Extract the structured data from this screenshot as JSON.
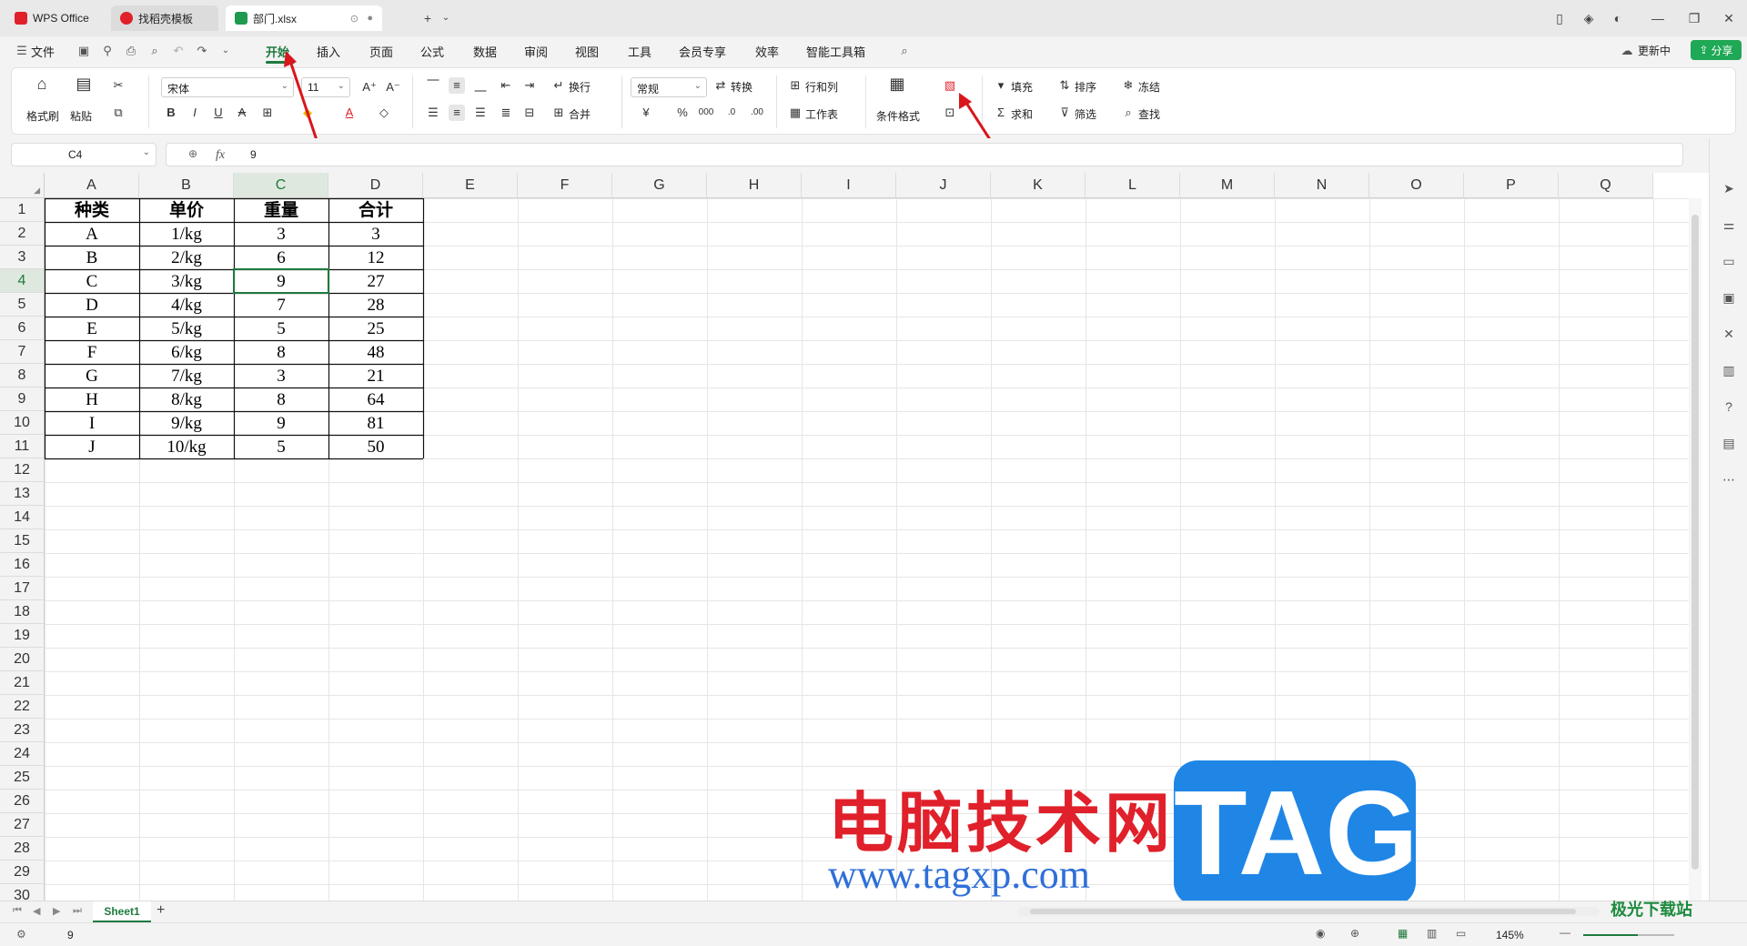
{
  "tabs": [
    {
      "label": "WPS Office",
      "color": "#e0202a"
    },
    {
      "label": "找稻壳模板",
      "color": "#e0202a"
    },
    {
      "label": "部门.xlsx",
      "color": "#1e9a4e"
    }
  ],
  "menu": {
    "file": "文件",
    "items": [
      "开始",
      "插入",
      "页面",
      "公式",
      "数据",
      "审阅",
      "视图",
      "工具",
      "会员专享",
      "效率",
      "智能工具箱"
    ],
    "active": "开始",
    "update": "更新中",
    "share": "分享"
  },
  "ribbon": {
    "format_painter": "格式刷",
    "paste": "粘贴",
    "font_name": "宋体",
    "font_size": "11",
    "wrap": "换行",
    "merge": "合并",
    "number_format": "常规",
    "convert": "转换",
    "rowcol": "行和列",
    "worksheet": "工作表",
    "cond_format": "条件格式",
    "fill": "填充",
    "sort": "排序",
    "freeze": "冻结",
    "sum": "求和",
    "filter": "筛选",
    "find": "查找"
  },
  "formula_bar": {
    "name_box": "C4",
    "fx": "fx",
    "value": "9"
  },
  "columns": [
    "A",
    "B",
    "C",
    "D",
    "E",
    "F",
    "G",
    "H",
    "I",
    "J",
    "K",
    "L",
    "M",
    "N",
    "O",
    "P",
    "Q"
  ],
  "rows": [
    "1",
    "2",
    "3",
    "4",
    "5",
    "6",
    "7",
    "8",
    "9",
    "10",
    "11",
    "12",
    "13",
    "14",
    "15",
    "16",
    "17",
    "18",
    "19",
    "20",
    "21",
    "22",
    "23",
    "24",
    "25",
    "26",
    "27",
    "28",
    "29",
    "30"
  ],
  "table": {
    "headers": [
      "种类",
      "单价",
      "重量",
      "合计"
    ],
    "data": [
      [
        "A",
        "1/kg",
        "3",
        "3"
      ],
      [
        "B",
        "2/kg",
        "6",
        "12"
      ],
      [
        "C",
        "3/kg",
        "9",
        "27"
      ],
      [
        "D",
        "4/kg",
        "7",
        "28"
      ],
      [
        "E",
        "5/kg",
        "5",
        "25"
      ],
      [
        "F",
        "6/kg",
        "8",
        "48"
      ],
      [
        "G",
        "7/kg",
        "3",
        "21"
      ],
      [
        "H",
        "8/kg",
        "8",
        "64"
      ],
      [
        "I",
        "9/kg",
        "9",
        "81"
      ],
      [
        "J",
        "10/kg",
        "5",
        "50"
      ]
    ]
  },
  "sheet": {
    "name": "Sheet1"
  },
  "status": {
    "value": "9",
    "zoom": "145%"
  },
  "watermark": {
    "cn": "电脑技术网",
    "url": "www.tagxp.com",
    "tag": "TAG",
    "corner": "极光下载站"
  },
  "accent": "#1e7a3e"
}
